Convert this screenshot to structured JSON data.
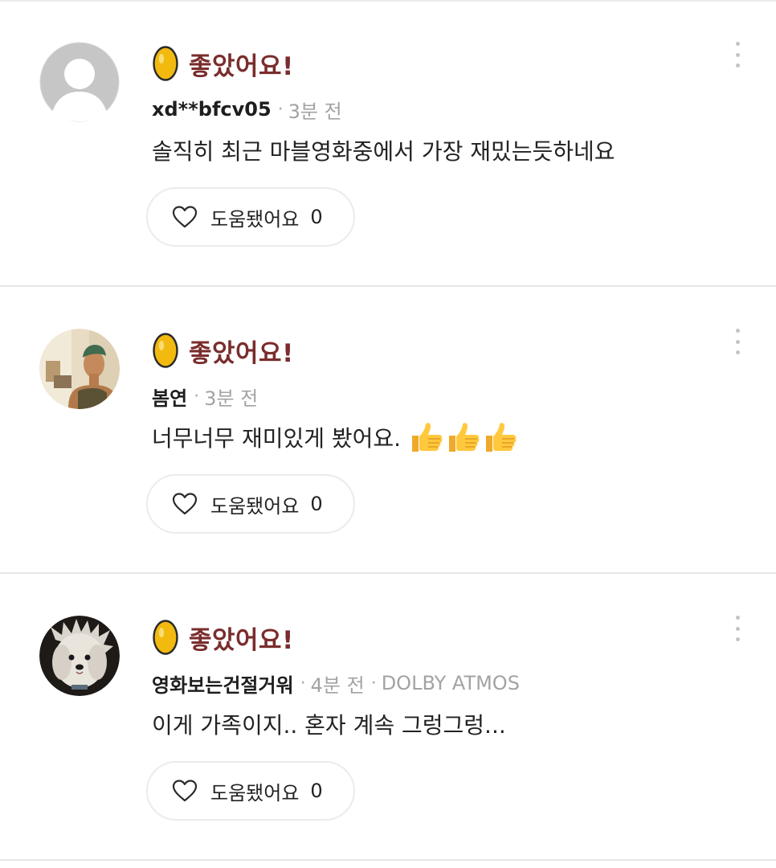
{
  "reviews": [
    {
      "rating_label": "좋았어요!",
      "username": "xd**bfcv05",
      "time": "3분 전",
      "extra": "",
      "comment": "솔직히 최근 마블영화중에서 가장 재밌는듯하네요",
      "avatar": "default-person-avatar",
      "help_label": "도움됐어요",
      "help_count": "0"
    },
    {
      "rating_label": "좋았어요!",
      "username": "봄연",
      "time": "3분 전",
      "extra": "",
      "comment": "너무너무 재미있게 봤어요.",
      "comment_emoji": [
        "thumbs-up-icon",
        "thumbs-up-icon",
        "thumbs-up-icon"
      ],
      "avatar": "man-photo-avatar",
      "help_label": "도움됐어요",
      "help_count": "0"
    },
    {
      "rating_label": "좋았어요!",
      "username": "영화보는건절거워",
      "time": "4분 전",
      "extra": "DOLBY ATMOS",
      "comment": "이게 가족이지.. 혼자 계속 그렁그렁...",
      "avatar": "white-dog-photo-avatar",
      "help_label": "도움됐어요",
      "help_count": "0"
    }
  ],
  "colors": {
    "rating_label": "#7a2d2d",
    "egg_fill": "#f2b90f",
    "meta_text": "#a3a3a3",
    "divider": "#e6e6e6"
  }
}
